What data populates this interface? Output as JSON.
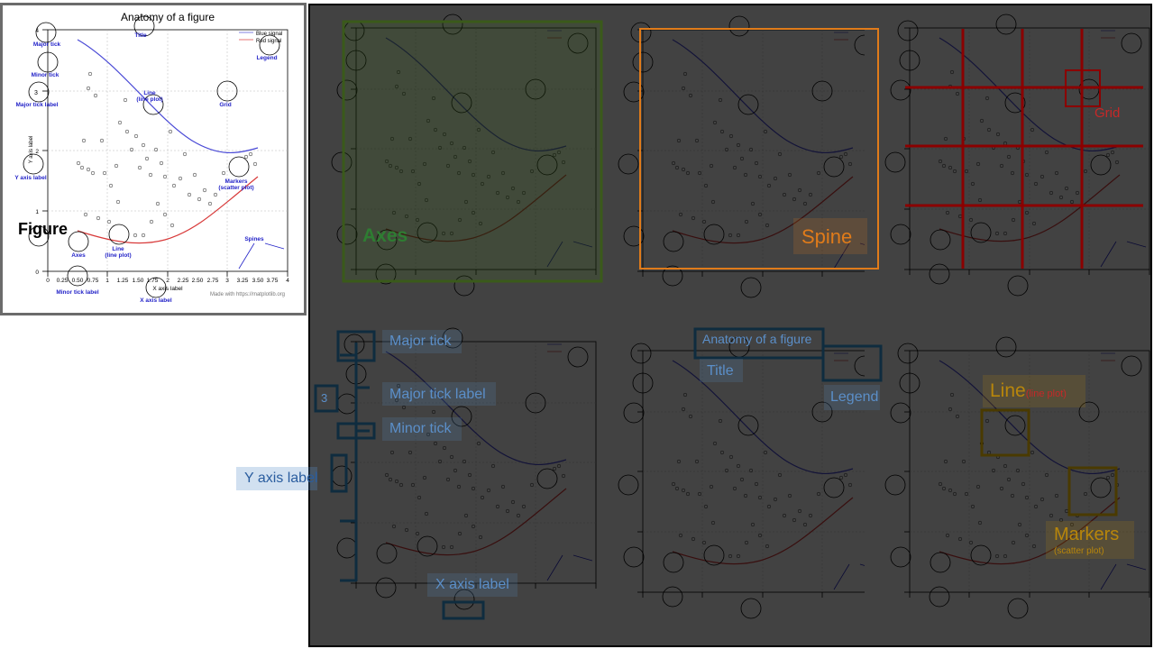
{
  "panel": {
    "title": "Anatomy of a figure",
    "legend": [
      "Blue signal",
      "Red signal"
    ],
    "credit": "Made with https://matplotlib.org",
    "ylabel_rot": "Y axis label",
    "xlabel_small": "X axis label",
    "xticks": [
      "0",
      "0.25",
      "0.50",
      "0.75",
      "1",
      "1.25",
      "1.50",
      "1.75",
      "2",
      "2.25",
      "2.50",
      "2.75",
      "3",
      "3.25",
      "3.50",
      "3.75",
      "4"
    ],
    "yticks": [
      "0",
      "1",
      "2",
      "3",
      "4"
    ],
    "callouts": {
      "title": "Title",
      "major_tick": "Major tick",
      "minor_tick": "Minor tick",
      "major_tick_label": "Major tick label",
      "grid": "Grid",
      "line1": "Line",
      "line2": "(line plot)",
      "legend": "Legend",
      "y_axis_label": "Y axis label",
      "markers1": "Markers",
      "markers2": "(scatter plot)",
      "spines": "Spines",
      "figure": "Figure",
      "axes": "Axes",
      "minor_tick_label": "Minor tick label",
      "x_axis_label": "X axis label",
      "three": "3"
    }
  },
  "figure_label": "Figure",
  "annotations": {
    "axes": "Axes",
    "spine": "Spine",
    "grid": "Grid",
    "major_tick": "Major tick",
    "major_tick_label": "Major tick label",
    "minor_tick": "Minor tick",
    "y_axis_label": "Y axis label",
    "x_axis_label": "X axis label",
    "title": "Title",
    "title_box": "Anatomy of a figure",
    "legend": "Legend",
    "line_big": "Line",
    "line_small": "(line plot)",
    "markers_big": "Markers",
    "markers_small": "(scatter plot)",
    "three": "3"
  },
  "colors": {
    "blue_signal": "#4a4ad6",
    "red_signal": "#d83a3a",
    "callout_text": "#2323c8",
    "axes_green": "#2e7d32",
    "spine_orange": "#e07b1a",
    "grid_red": "#8b0000",
    "tick_blue": "#5b8fc9",
    "line_gold": "#b8860b"
  }
}
